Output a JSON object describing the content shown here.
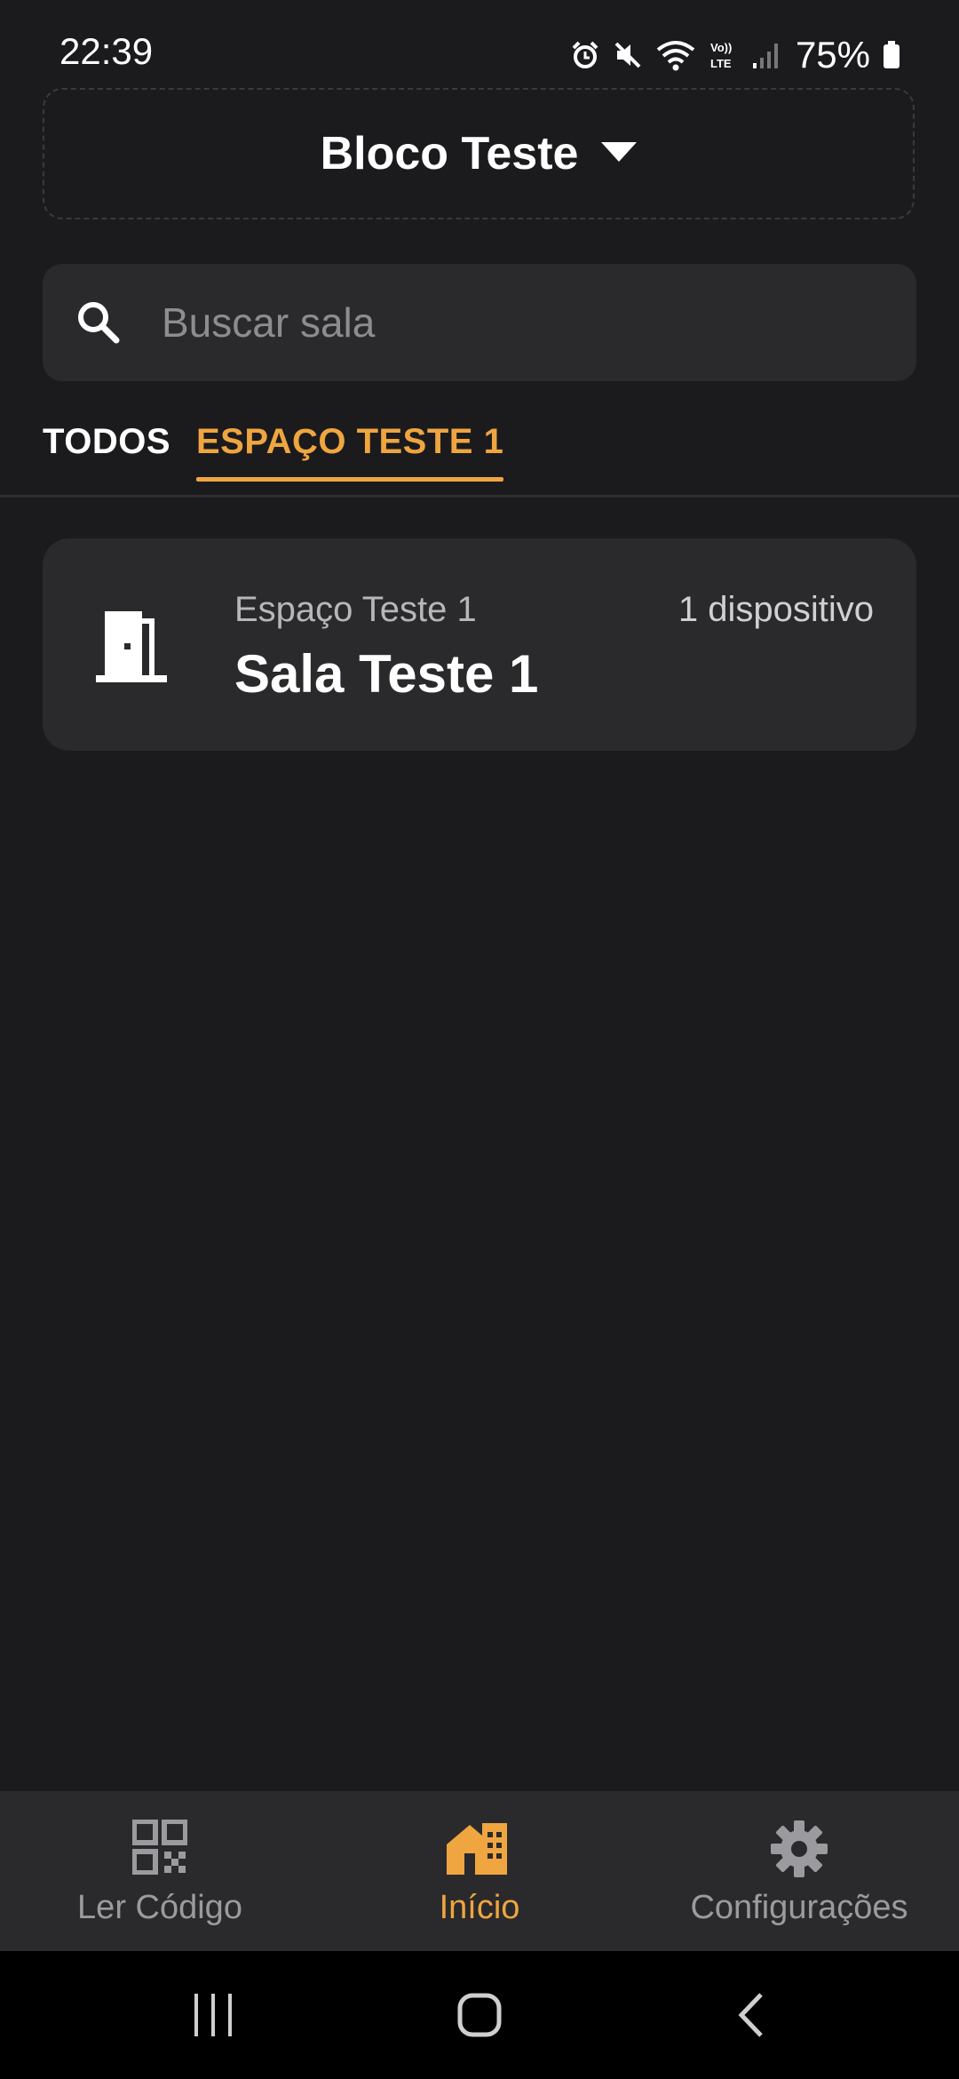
{
  "status_bar": {
    "time": "22:39",
    "battery": "75%"
  },
  "block_selector": {
    "title": "Bloco Teste"
  },
  "search": {
    "placeholder": "Buscar sala"
  },
  "tabs": [
    {
      "label": "TODOS",
      "active": false
    },
    {
      "label": "ESPAÇO TESTE 1",
      "active": true
    }
  ],
  "rooms": [
    {
      "space": "Espaço Teste 1",
      "name": "Sala Teste 1",
      "devices": "1 dispositivo"
    }
  ],
  "bottom_nav": [
    {
      "label": "Ler Código",
      "icon": "qr-code-icon",
      "active": false
    },
    {
      "label": "Início",
      "icon": "home-icon",
      "active": true
    },
    {
      "label": "Configurações",
      "icon": "gear-icon",
      "active": false
    }
  ],
  "colors": {
    "accent": "#efa540",
    "background": "#1b1b1d",
    "surface": "#2a2a2c"
  }
}
